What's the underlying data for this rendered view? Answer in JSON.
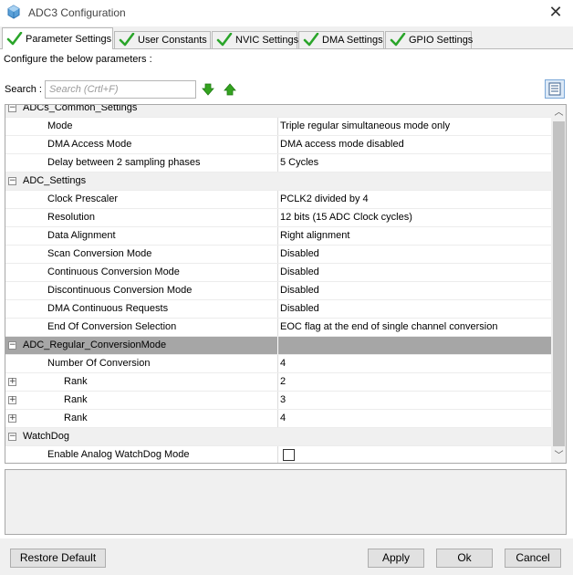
{
  "window": {
    "title": "ADC3 Configuration",
    "close_glyph": "✕"
  },
  "tabs": [
    {
      "label": "Parameter Settings",
      "active": true,
      "icon": "checkmark-icon"
    },
    {
      "label": "User Constants",
      "active": false,
      "icon": "checkmark-icon"
    },
    {
      "label": "NVIC Settings",
      "active": false,
      "icon": "checkmark-icon"
    },
    {
      "label": "DMA Settings",
      "active": false,
      "icon": "checkmark-icon"
    },
    {
      "label": "GPIO Settings",
      "active": false,
      "icon": "checkmark-icon"
    }
  ],
  "toolbar": {
    "configure_label": "Configure the below parameters :",
    "search_label": "Search :",
    "search_placeholder": "Search (Crtl+F)",
    "search_value": "",
    "next_icon": "arrow-down-icon",
    "prev_icon": "arrow-up-icon",
    "view_icon": "list-view-icon"
  },
  "groups": [
    {
      "name": "ADCs_Common_Settings",
      "params": [
        {
          "name": "Mode",
          "value": "Triple regular simultaneous mode only"
        },
        {
          "name": "DMA Access Mode",
          "value": "DMA access mode disabled"
        },
        {
          "name": "Delay between 2 sampling phases",
          "value": "5 Cycles"
        }
      ]
    },
    {
      "name": "ADC_Settings",
      "params": [
        {
          "name": "Clock Prescaler",
          "value": "PCLK2 divided by 4"
        },
        {
          "name": "Resolution",
          "value": "12 bits (15 ADC Clock cycles)"
        },
        {
          "name": "Data Alignment",
          "value": "Right alignment"
        },
        {
          "name": "Scan Conversion Mode",
          "value": "Disabled"
        },
        {
          "name": "Continuous Conversion Mode",
          "value": "Disabled"
        },
        {
          "name": "Discontinuous Conversion Mode",
          "value": "Disabled"
        },
        {
          "name": "DMA Continuous Requests",
          "value": "Disabled"
        },
        {
          "name": "End Of Conversion Selection",
          "value": "EOC flag at the end of single channel conversion"
        }
      ]
    },
    {
      "name": "ADC_Regular_ConversionMode",
      "selected": true,
      "params": [
        {
          "name": "Number Of Conversion",
          "value": "4"
        },
        {
          "name": "Rank",
          "value": "2",
          "expandable": true
        },
        {
          "name": "Rank",
          "value": "3",
          "expandable": true
        },
        {
          "name": "Rank",
          "value": "4",
          "expandable": true
        }
      ]
    },
    {
      "name": "WatchDog",
      "params": [
        {
          "name": "Enable Analog WatchDog Mode",
          "value": "",
          "checkbox": true,
          "checked": false
        }
      ]
    }
  ],
  "footer": {
    "restore_default": "Restore Default",
    "apply": "Apply",
    "ok": "Ok",
    "cancel": "Cancel"
  },
  "colors": {
    "selected_row": "#a6a6a6",
    "group_row": "#f0f0f0",
    "check_green": "#2aa52a",
    "arrow_green": "#34a320"
  }
}
